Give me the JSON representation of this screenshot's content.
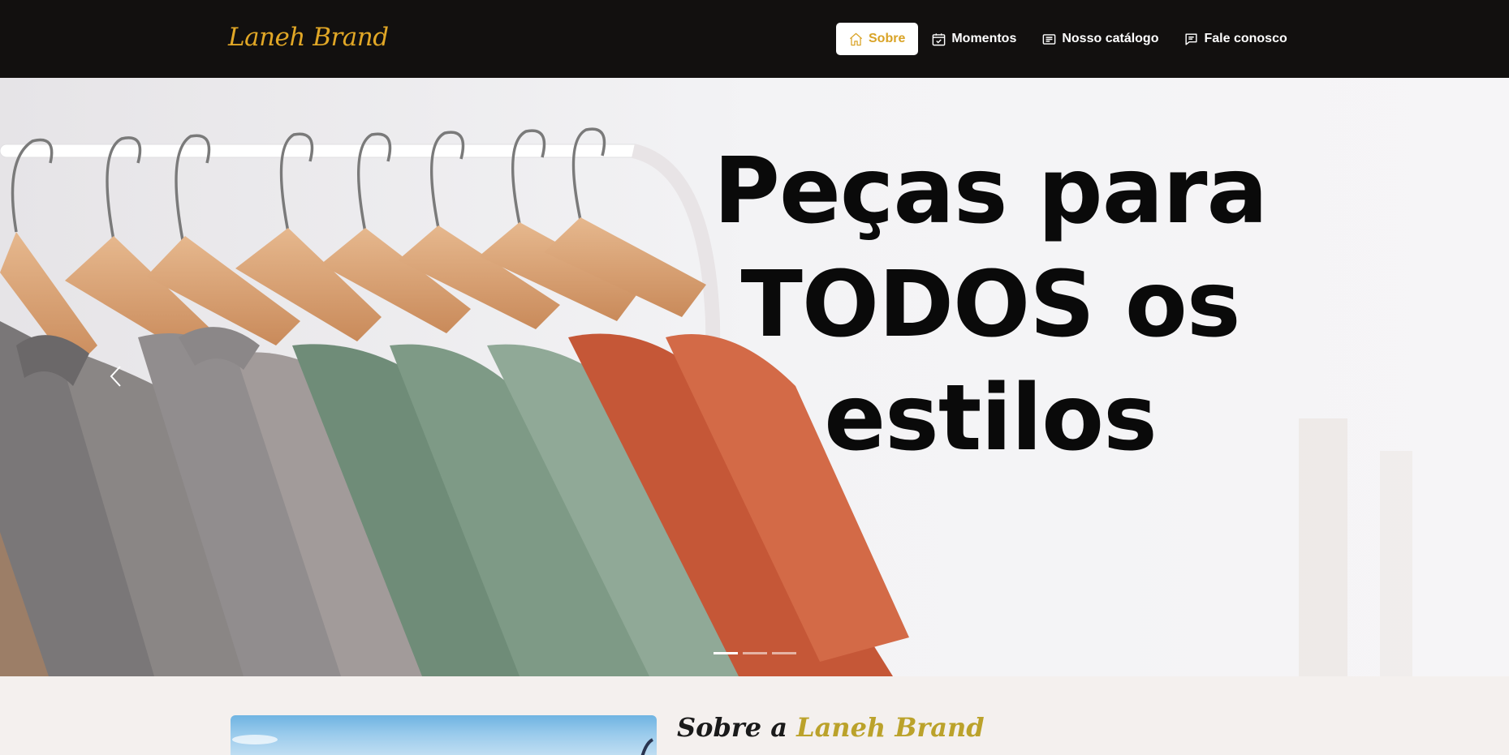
{
  "brand": {
    "name": "Laneh Brand",
    "color": "#e1a726"
  },
  "nav": {
    "items": [
      {
        "label": "Sobre",
        "icon": "home-icon",
        "active": true
      },
      {
        "label": "Momentos",
        "icon": "calendar-check-icon",
        "active": false
      },
      {
        "label": "Nosso catálogo",
        "icon": "newspaper-icon",
        "active": false
      },
      {
        "label": "Fale conosco",
        "icon": "chat-icon",
        "active": false
      }
    ]
  },
  "hero": {
    "title_lines": [
      "Peças para",
      "TODOS os",
      "estilos"
    ],
    "prev_icon": "chevron-left-icon",
    "slides_total": 3,
    "active_slide": 1
  },
  "about": {
    "title_prefix": "Sobre a ",
    "title_accent": "Laneh Brand",
    "accent_color": "#bba22b"
  }
}
